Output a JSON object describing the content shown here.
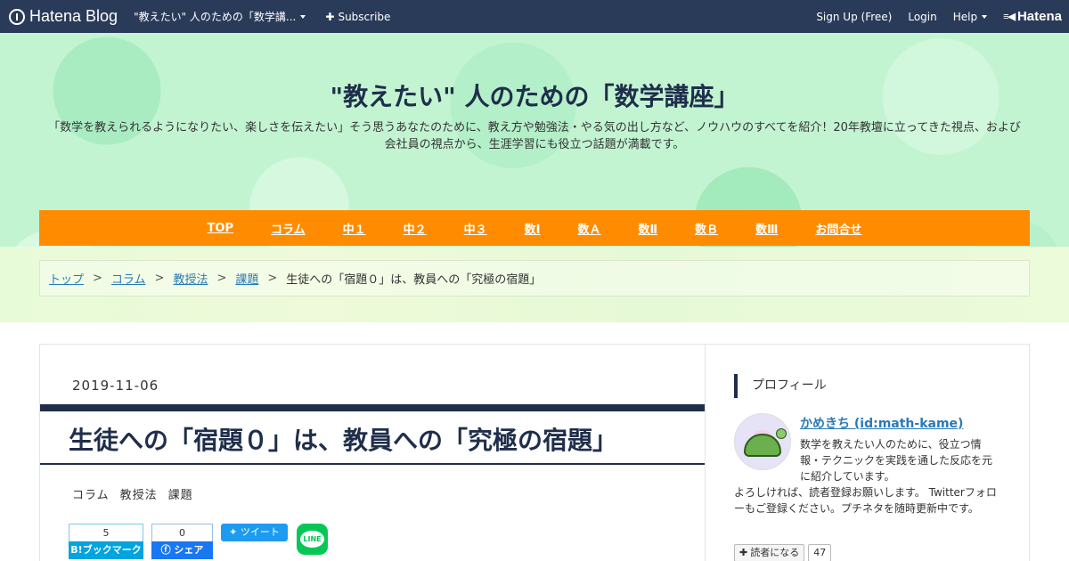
{
  "globalbar": {
    "logo_text": "Hatena Blog",
    "blog_name": "\"教えたい\" 人のための「数学講...",
    "subscribe": "Subscribe",
    "signup": "Sign Up (Free)",
    "login": "Login",
    "help": "Help",
    "brand": "Hatena"
  },
  "header": {
    "title": "\"教えたい\" 人のための「数学講座」",
    "description": "「数学を教えられるようになりたい、楽しさを伝えたい」そう思うあなたのために、教え方や勉強法・やる気の出し方など、ノウハウのすべてを紹介！20年教壇に立ってきた視点、および会社員の視点から、生涯学習にも役立つ話題が満載です。"
  },
  "nav": {
    "items": [
      "TOP",
      "コラム",
      "中１",
      "中２",
      "中３",
      "数Ⅰ",
      "数Ａ",
      "数Ⅱ",
      "数Ｂ",
      "数Ⅲ",
      "お問合せ"
    ]
  },
  "breadcrumb": {
    "items": [
      "トップ",
      "コラム",
      "教授法",
      "課題"
    ],
    "separator": ">",
    "current": "生徒への「宿題０」は、教員への「究極の宿題」"
  },
  "entry": {
    "date": "2019-11-06",
    "title": "生徒への「宿題０」は、教員への「究極の宿題」",
    "categories": [
      "コラム",
      "教授法",
      "課題"
    ]
  },
  "share": {
    "hatena_count": "5",
    "hatena_label": "B!ブックマーク",
    "fb_count": "0",
    "fb_label": "シェア",
    "tweet_label": "ツイート",
    "line_label": "LINE"
  },
  "sidebar": {
    "heading": "プロフィール",
    "name": "かめきち (id:math-kame)",
    "description": "数学を教えたい人のために、役立つ情報・テクニックを実践を通した反応を元に紹介しています。",
    "description2": "よろしければ、読者登録お願いします。 Twitterフォローもご登録ください。プチネタを随時更新中です。",
    "reader_button": "読者になる",
    "reader_count": "47"
  }
}
